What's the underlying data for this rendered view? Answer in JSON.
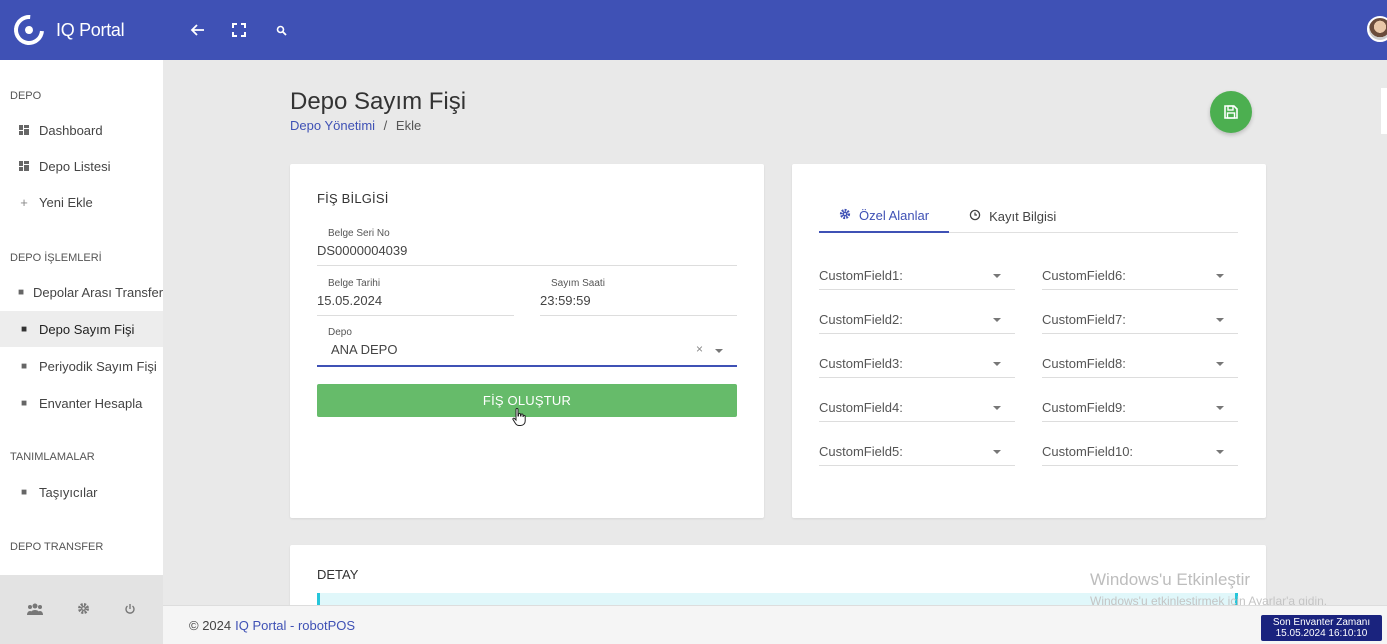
{
  "app": {
    "title": "IQ Portal"
  },
  "sidebar": {
    "sections": [
      {
        "title": "DEPO"
      },
      {
        "title": "DEPO İŞLEMLERİ"
      },
      {
        "title": "TANIMLAMALAR"
      },
      {
        "title": "DEPO TRANSFER"
      }
    ],
    "items": [
      {
        "label": "Dashboard",
        "icon": "dashboard-icon"
      },
      {
        "label": "Depo Listesi",
        "icon": "dashboard-icon"
      },
      {
        "label": "Yeni Ekle",
        "icon": "plus-icon"
      },
      {
        "label": "Depolar Arası Transfer",
        "icon": "bullet-icon"
      },
      {
        "label": "Depo Sayım Fişi",
        "icon": "bullet-icon",
        "active": true
      },
      {
        "label": "Periyodik Sayım Fişi",
        "icon": "bullet-icon"
      },
      {
        "label": "Envanter Hesapla",
        "icon": "bullet-icon"
      },
      {
        "label": "Taşıyıcılar",
        "icon": "bullet-icon"
      }
    ]
  },
  "page": {
    "title": "Depo Sayım Fişi",
    "breadcrumb": {
      "parent": "Depo Yönetimi",
      "separator": "/",
      "current": "Ekle"
    }
  },
  "fis": {
    "title": "FİŞ BİLGİSİ",
    "belge_seri_no": {
      "label": "Belge Seri No",
      "value": "DS0000004039"
    },
    "belge_tarihi": {
      "label": "Belge Tarihi",
      "value": "15.05.2024"
    },
    "sayim_saati": {
      "label": "Sayım Saati",
      "value": "23:59:59"
    },
    "depo": {
      "label": "Depo",
      "value": "ANA DEPO",
      "clear": "×"
    },
    "create_button": "FİŞ OLUŞTUR"
  },
  "tabs": [
    {
      "label": "Özel Alanlar",
      "icon": "gear-icon",
      "active": true
    },
    {
      "label": "Kayıt Bilgisi",
      "icon": "clock-icon"
    }
  ],
  "custom_fields": {
    "left": [
      "CustomField1:",
      "CustomField2:",
      "CustomField3:",
      "CustomField4:",
      "CustomField5:"
    ],
    "right": [
      "CustomField6:",
      "CustomField7:",
      "CustomField8:",
      "CustomField9:",
      "CustomField10:"
    ]
  },
  "detail": {
    "title": "DETAY"
  },
  "watermark": {
    "line1": "Windows'u Etkinleştir",
    "line2": "Windows'u etkinleştirmek için Ayarlar'a gidin."
  },
  "footer": {
    "copyright": "© 2024",
    "link": "IQ Portal - robotPOS"
  },
  "inventory_badge": {
    "line1": "Son Envanter Zamanı",
    "line2": "15.05.2024 16:10:10"
  },
  "colors": {
    "primary": "#3f51b5",
    "success": "#66bb6a",
    "fab": "#4caf50"
  }
}
